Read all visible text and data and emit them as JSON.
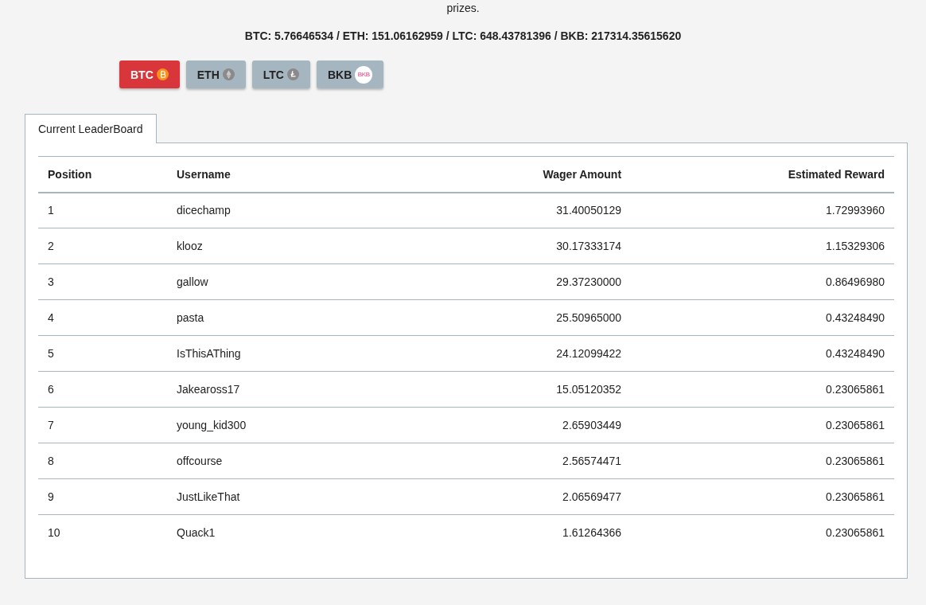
{
  "intro": "prizes.",
  "totals": "BTC: 5.76646534 / ETH: 151.06162959 / LTC: 648.43781396 / BKB: 217314.35615620",
  "currencies": [
    {
      "label": "BTC",
      "kind": "btc",
      "selected": true
    },
    {
      "label": "ETH",
      "kind": "eth",
      "selected": false
    },
    {
      "label": "LTC",
      "kind": "ltc",
      "selected": false
    },
    {
      "label": "BKB",
      "kind": "bkb",
      "selected": false,
      "icon_text": "BKB"
    }
  ],
  "tabs": [
    {
      "label": "Current LeaderBoard",
      "selected": true
    }
  ],
  "table": {
    "columns": [
      "Position",
      "Username",
      "Wager Amount",
      "Estimated Reward"
    ],
    "rows": [
      [
        "1",
        "dicechamp",
        "31.40050129",
        "1.72993960"
      ],
      [
        "2",
        "klooz",
        "30.17333174",
        "1.15329306"
      ],
      [
        "3",
        "gallow",
        "29.37230000",
        "0.86496980"
      ],
      [
        "4",
        "pasta",
        "25.50965000",
        "0.43248490"
      ],
      [
        "5",
        "IsThisAThing",
        "24.12099422",
        "0.43248490"
      ],
      [
        "6",
        "Jakeaross17",
        "15.05120352",
        "0.23065861"
      ],
      [
        "7",
        "young_kid300",
        "2.65903449",
        "0.23065861"
      ],
      [
        "8",
        "offcourse",
        "2.56574471",
        "0.23065861"
      ],
      [
        "9",
        "JustLikeThat",
        "2.06569477",
        "0.23065861"
      ],
      [
        "10",
        "Quack1",
        "1.61264366",
        "0.23065861"
      ]
    ]
  }
}
